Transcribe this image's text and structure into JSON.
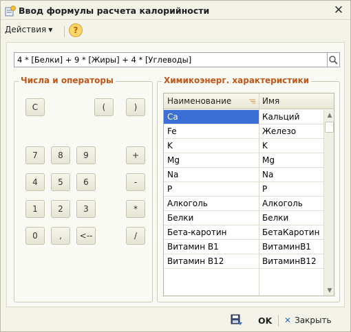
{
  "window": {
    "title": "Ввод формулы расчета калорийности",
    "close_glyph": "✕"
  },
  "toolbar": {
    "actions_label": "Действия",
    "help_glyph": "?"
  },
  "formula": {
    "value": "4 * [Белки] + 9 * [Жиры] + 4 * [Углеводы]"
  },
  "operators_group": {
    "title": "Числа и операторы",
    "keys": {
      "clear": "C",
      "lparen": "(",
      "rparen": ")",
      "d7": "7",
      "d8": "8",
      "d9": "9",
      "plus": "+",
      "d4": "4",
      "d5": "5",
      "d6": "6",
      "minus": "-",
      "d1": "1",
      "d2": "2",
      "d3": "3",
      "multiply": "*",
      "d0": "0",
      "comma": ",",
      "backspace": "<--",
      "divide": "/"
    }
  },
  "chem_group": {
    "title": "Химикоэнерг. характеристики",
    "columns": {
      "name": "Наименование",
      "short": "Имя"
    },
    "rows": [
      {
        "name": "Ca",
        "short": "Кальций"
      },
      {
        "name": "Fe",
        "short": "Железо"
      },
      {
        "name": "K",
        "short": "K"
      },
      {
        "name": "Mg",
        "short": "Mg"
      },
      {
        "name": "Na",
        "short": "Na"
      },
      {
        "name": "P",
        "short": "P"
      },
      {
        "name": "Алкоголь",
        "short": "Алкоголь"
      },
      {
        "name": "Белки",
        "short": "Белки"
      },
      {
        "name": "Бета-каротин",
        "short": "БетаКаротин"
      },
      {
        "name": "Витамин B1",
        "short": "ВитаминB1"
      },
      {
        "name": "Витамин B12",
        "short": "ВитаминB12"
      }
    ],
    "selected_row": 0
  },
  "footer": {
    "ok_label": "OK",
    "close_label": "Закрыть"
  },
  "colors": {
    "accent": "#c0571a",
    "selection": "#3b6fd6"
  }
}
